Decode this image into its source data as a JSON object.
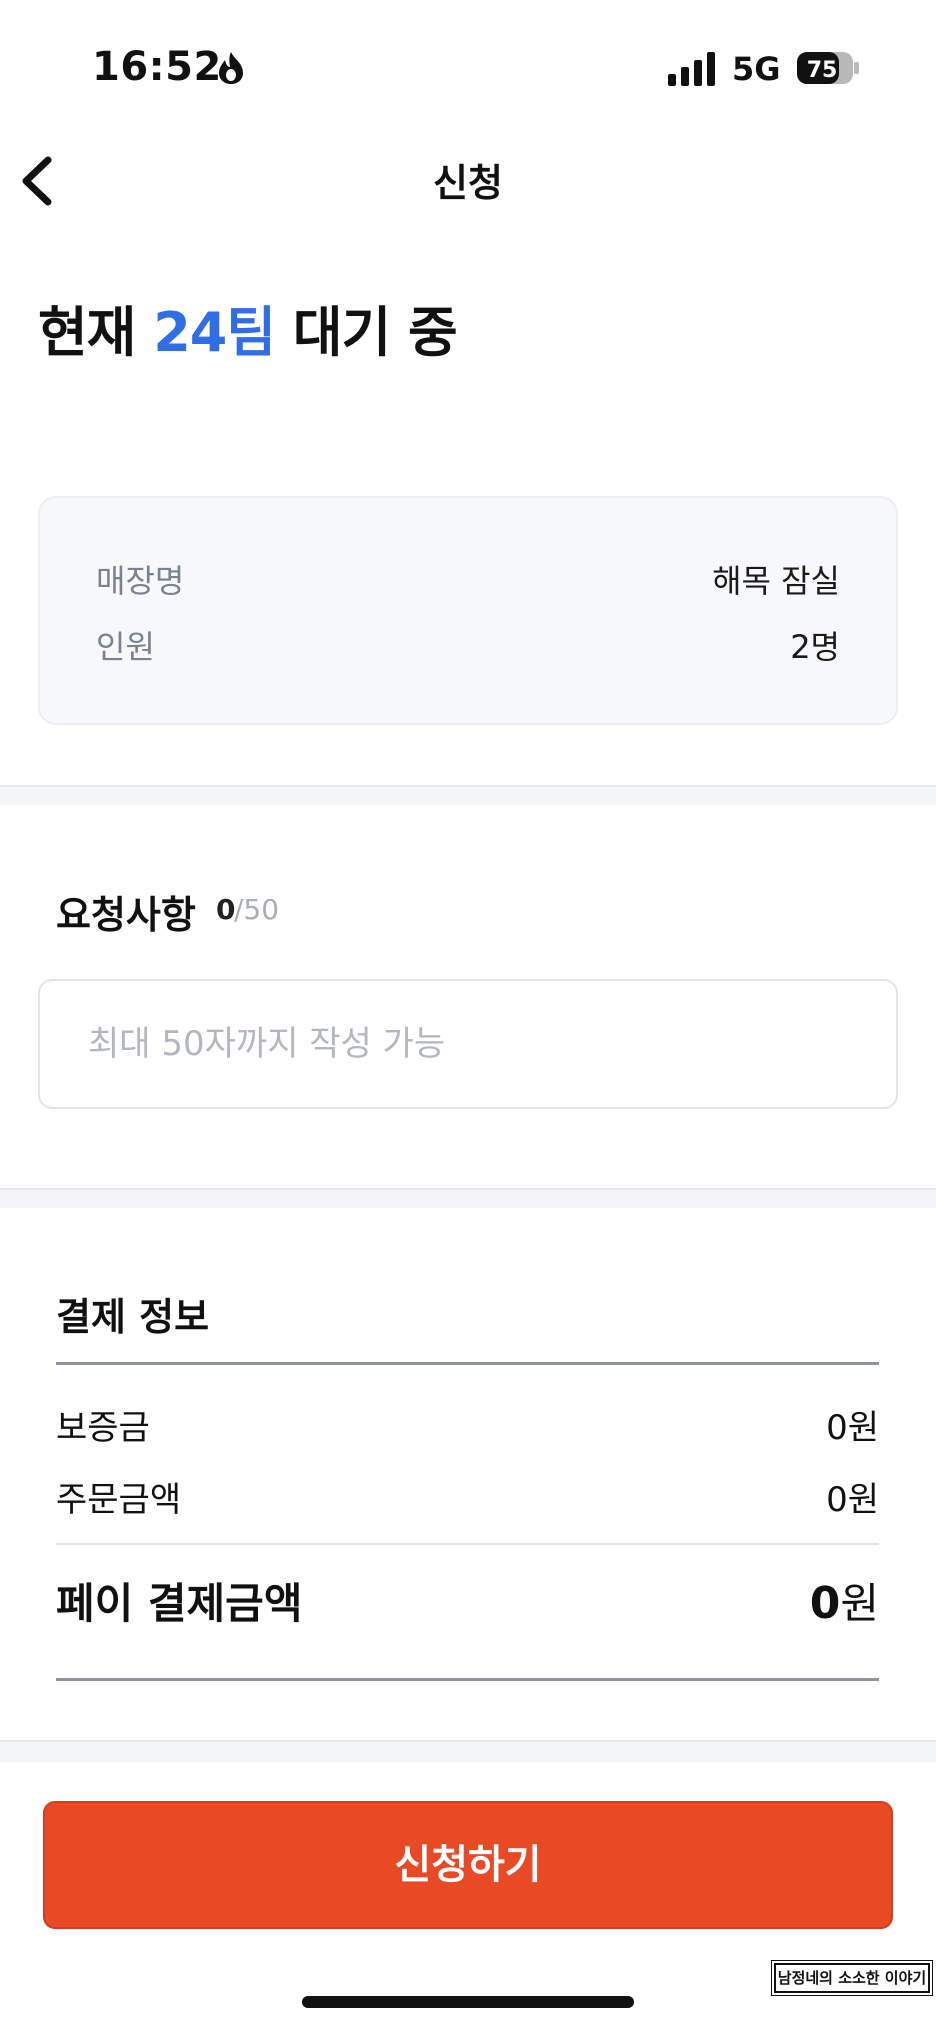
{
  "status_bar": {
    "time": "16:52",
    "network": "5G",
    "battery": "75",
    "icons": [
      "flame-icon",
      "signal-icon",
      "battery-icon"
    ]
  },
  "header": {
    "title": "신청",
    "back_icon": "chevron-left-icon"
  },
  "wait": {
    "prefix": "현재",
    "count": "24팀",
    "suffix": "대기 중"
  },
  "store_info": {
    "store_label": "매장명",
    "store_value": "해목 잠실",
    "party_label": "인원",
    "party_value": "2명"
  },
  "request": {
    "label": "요청사항",
    "count": "0",
    "max": "/50",
    "placeholder": "최대 50자까지 작성 가능",
    "value": ""
  },
  "payment": {
    "title": "결제 정보",
    "deposit_label": "보증금",
    "deposit_value": "0원",
    "order_label": "주문금액",
    "order_value": "0원",
    "total_label": "페이 결제금액",
    "total_amount": "0",
    "total_unit": "원"
  },
  "cta": {
    "label": "신청하기"
  },
  "watermark": "남정네의 소소한 이야기",
  "colors": {
    "accent": "#2f6ee6",
    "cta": "#e94a26",
    "card_bg": "#f7f8fa",
    "muted": "#7a8190"
  }
}
